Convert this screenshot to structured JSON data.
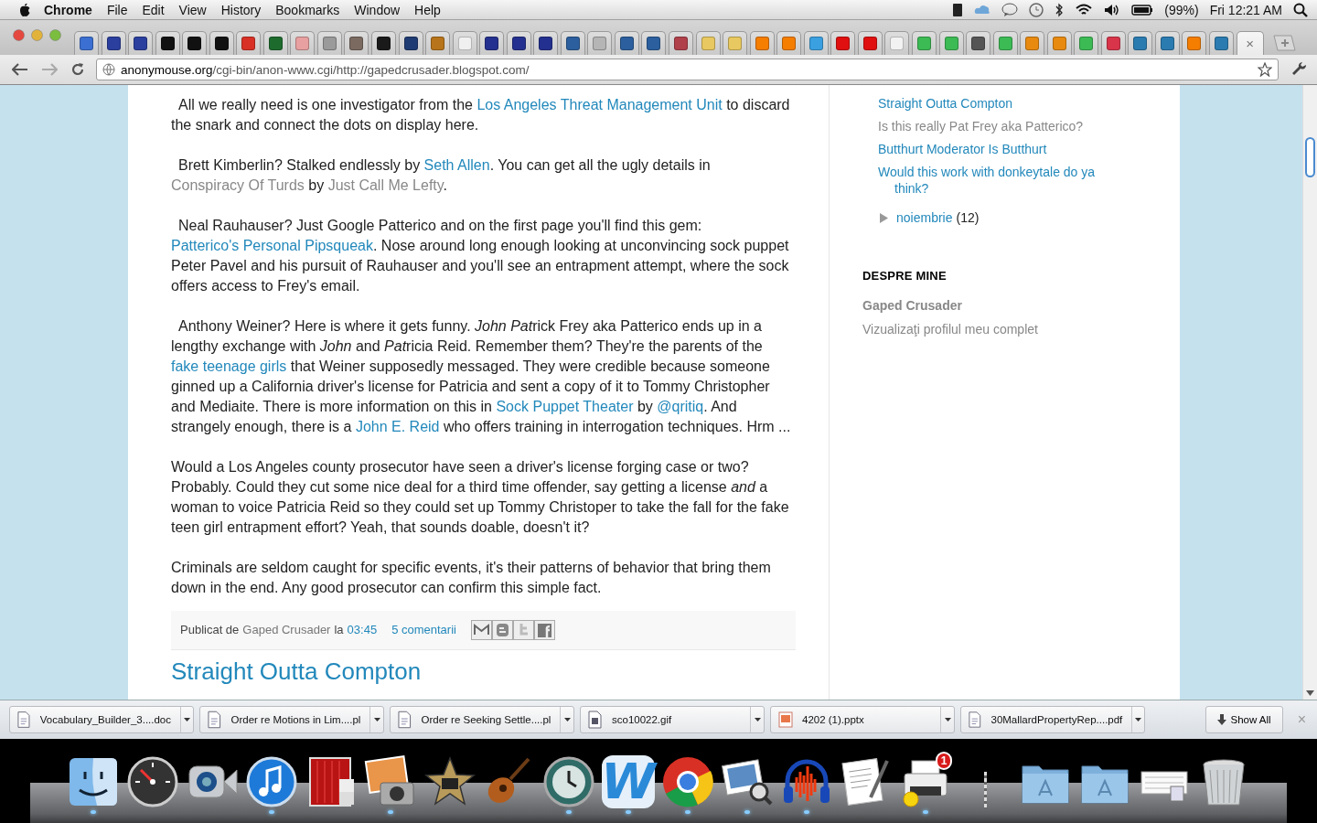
{
  "menubar": {
    "app": "Chrome",
    "menus": [
      "File",
      "Edit",
      "View",
      "History",
      "Bookmarks",
      "Window",
      "Help"
    ],
    "battery": "(99%)",
    "clock": "Fri 12:21 AM"
  },
  "tabs": [
    {
      "color": "#3b6fd1",
      "selected": false
    },
    {
      "color": "#2a3f9e",
      "selected": false
    },
    {
      "color": "#2a3f9e",
      "selected": false
    },
    {
      "color": "#111111",
      "selected": false
    },
    {
      "color": "#111111",
      "selected": false
    },
    {
      "color": "#111111",
      "selected": false
    },
    {
      "color": "#d93025",
      "selected": false
    },
    {
      "color": "#1e6b2e",
      "selected": false
    },
    {
      "color": "#e8a0a0",
      "selected": false
    },
    {
      "color": "#9a9a9a",
      "selected": false
    },
    {
      "color": "#7a6a60",
      "selected": false
    },
    {
      "color": "#1a1a1a",
      "selected": false
    },
    {
      "color": "#1f3b73",
      "selected": false
    },
    {
      "color": "#b8741a",
      "selected": false
    },
    {
      "color": "#f0f0f0",
      "selected": false
    },
    {
      "color": "#23308f",
      "selected": false
    },
    {
      "color": "#23308f",
      "selected": false
    },
    {
      "color": "#23308f",
      "selected": false
    },
    {
      "color": "#2b5f9e",
      "selected": false
    },
    {
      "color": "#b5b5b5",
      "selected": false
    },
    {
      "color": "#2b5f9e",
      "selected": false
    },
    {
      "color": "#2b5f9e",
      "selected": false
    },
    {
      "color": "#b0404a",
      "selected": false
    },
    {
      "color": "#e8c860",
      "selected": false
    },
    {
      "color": "#e8c860",
      "selected": false
    },
    {
      "color": "#f57d00",
      "selected": false
    },
    {
      "color": "#f57d00",
      "selected": false
    },
    {
      "color": "#3aa0e0",
      "selected": false
    },
    {
      "color": "#e01010",
      "selected": false
    },
    {
      "color": "#e01010",
      "selected": false
    },
    {
      "color": "#f2f2f2",
      "selected": false
    },
    {
      "color": "#3cba54",
      "selected": false
    },
    {
      "color": "#3cba54",
      "selected": false
    },
    {
      "color": "#555555",
      "selected": false
    },
    {
      "color": "#3cba54",
      "selected": false
    },
    {
      "color": "#e88a10",
      "selected": false
    },
    {
      "color": "#e88a10",
      "selected": false
    },
    {
      "color": "#3cba54",
      "selected": false
    },
    {
      "color": "#d8344a",
      "selected": false
    },
    {
      "color": "#2a7bb0",
      "selected": false
    },
    {
      "color": "#2a7bb0",
      "selected": false
    },
    {
      "color": "#f57d00",
      "selected": false
    },
    {
      "color": "#2a7bb0",
      "selected": false
    },
    {
      "selected": true,
      "close": "×"
    }
  ],
  "toolbar": {
    "url_host": "anonymouse.org",
    "url_path": "/cgi-bin/anon-www.cgi/http://gapedcrusader.blogspot.com/"
  },
  "post": {
    "paragraphs": [
      [
        {
          "text": "All we really need is one investigator from the ",
          "kind": "plain"
        },
        {
          "text": "Los Angeles Threat Management Unit",
          "kind": "link"
        },
        {
          "text": " to discard the snark and connect the dots on display here.",
          "kind": "plain"
        }
      ],
      [
        {
          "text": "Brett Kimberlin? Stalked endlessly by ",
          "kind": "plain"
        },
        {
          "text": "Seth Allen",
          "kind": "link"
        },
        {
          "text": ". You can get all the ugly details in ",
          "kind": "plain"
        },
        {
          "text": "Conspiracy Of Turds",
          "kind": "muted"
        },
        {
          "text": " by ",
          "kind": "plain"
        },
        {
          "text": "Just Call Me Lefty",
          "kind": "muted"
        },
        {
          "text": ".",
          "kind": "plain"
        }
      ],
      [
        {
          "text": "Neal Rauhauser? Just Google Patterico and on the first page you'll find this gem: ",
          "kind": "plain"
        },
        {
          "text": "Patterico's Personal Pipsqueak",
          "kind": "link"
        },
        {
          "text": ". Nose around long enough looking at unconvincing sock puppet Peter Pavel and his pursuit of Rauhauser and you'll see an entrapment attempt, where the sock offers access to Frey's email.",
          "kind": "plain"
        }
      ],
      [
        {
          "text": "Anthony Weiner? Here is where it gets funny. ",
          "kind": "plain"
        },
        {
          "text": "John Pat",
          "kind": "italic"
        },
        {
          "text": "rick Frey aka Patterico ends up in a lengthy exchange with ",
          "kind": "plain"
        },
        {
          "text": "John",
          "kind": "italic"
        },
        {
          "text": " and ",
          "kind": "plain"
        },
        {
          "text": "Pat",
          "kind": "italic"
        },
        {
          "text": "ricia Reid. Remember them? They're the parents of the ",
          "kind": "plain"
        },
        {
          "text": "fake teenage girls",
          "kind": "link"
        },
        {
          "text": " that Weiner supposedly messaged. They were credible because someone ginned up a California driver's license for Patricia and sent a copy of it to Tommy Christopher and Mediaite. There is more information on this in ",
          "kind": "plain"
        },
        {
          "text": "Sock Puppet Theater",
          "kind": "link"
        },
        {
          "text": " by ",
          "kind": "plain"
        },
        {
          "text": "@qritiq",
          "kind": "link"
        },
        {
          "text": ". And strangely enough, there is a ",
          "kind": "plain"
        },
        {
          "text": "John E. Reid",
          "kind": "link"
        },
        {
          "text": " who offers training in interrogation techniques. Hrm ...",
          "kind": "plain"
        }
      ],
      [
        {
          "text": "Would a Los Angeles county prosecutor have seen a driver's license forging case or two? Probably. Could they cut some nice deal for a third time offender, say getting a license ",
          "kind": "plain"
        },
        {
          "text": "and",
          "kind": "italic"
        },
        {
          "text": " a woman to voice Patricia Reid so they could set up Tommy Christoper to take the fall for the fake teen girl entrapment effort? Yeah, that sounds doable, doesn't it?",
          "kind": "plain"
        }
      ],
      [
        {
          "text": "Criminals are seldom caught for specific events, it's their patterns of behavior that bring them down in the end. Any good prosecutor can confirm this simple fact.",
          "kind": "plain"
        }
      ]
    ],
    "footer": {
      "by_label": "Publicat de",
      "author": "Gaped Crusader",
      "at_label": "la",
      "time": "03:45",
      "comments": "5 comentarii"
    },
    "share": [
      {
        "kind": "email"
      },
      {
        "kind": "blog"
      },
      {
        "kind": "twitter"
      },
      {
        "kind": "facebook"
      }
    ],
    "next_title": "Straight Outta Compton"
  },
  "sidebar": {
    "archive_links": [
      {
        "text": "Straight Outta Compton",
        "visited": false
      },
      {
        "text": "Is this really Pat Frey aka Patterico?",
        "visited": true
      },
      {
        "text": "Butthurt Moderator Is Butthurt",
        "visited": false
      },
      {
        "text": "Would this work with donkeytale do ya think?",
        "visited": false
      }
    ],
    "month": {
      "name": "noiembrie",
      "count": "(12)",
      "expanded": false
    },
    "about_heading": "DESPRE MINE",
    "profile_name": "Gaped Crusader",
    "profile_link": "Vizualizaţi profilul meu complet"
  },
  "downloads": {
    "items": [
      {
        "name": "Vocabulary_Builder_3....doc",
        "kind": "doc"
      },
      {
        "name": "Order re Motions in Lim....pl",
        "kind": "doc"
      },
      {
        "name": "Order re Seeking Settle....pl",
        "kind": "doc"
      },
      {
        "name": "sco10022.gif",
        "kind": "image"
      },
      {
        "name": "4202 (1).pptx",
        "kind": "slides"
      },
      {
        "name": "30MallardPropertyRep....pdf",
        "kind": "doc"
      }
    ],
    "show_all": "Show All",
    "close": "×"
  },
  "dock": [
    {
      "kind": "finder",
      "running": true
    },
    {
      "kind": "gauge",
      "running": false
    },
    {
      "kind": "videocam",
      "running": false
    },
    {
      "kind": "music",
      "running": true
    },
    {
      "kind": "curtain",
      "running": false
    },
    {
      "kind": "camera",
      "running": true
    },
    {
      "kind": "star",
      "running": false
    },
    {
      "kind": "guitar",
      "running": false
    },
    {
      "kind": "clock",
      "running": true
    },
    {
      "kind": "letter",
      "glyph": "W",
      "running": true
    },
    {
      "kind": "browser",
      "running": true
    },
    {
      "kind": "preview",
      "running": true
    },
    {
      "kind": "headphones",
      "running": true
    },
    {
      "kind": "textedit",
      "running": false
    },
    {
      "kind": "printer",
      "badge": "1",
      "running": true
    },
    {
      "kind": "separator"
    },
    {
      "kind": "folder",
      "running": false
    },
    {
      "kind": "folder",
      "running": false
    },
    {
      "kind": "stack",
      "running": false
    },
    {
      "kind": "trash",
      "running": false
    }
  ]
}
